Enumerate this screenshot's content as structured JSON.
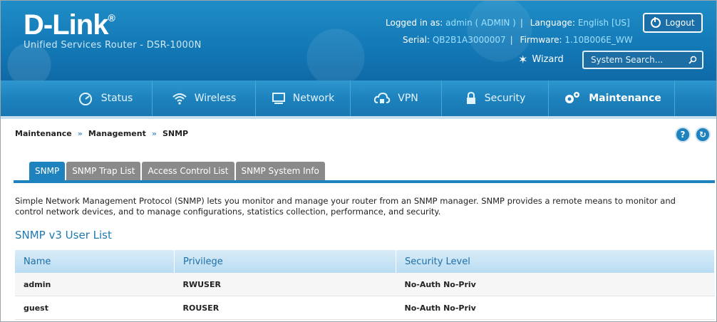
{
  "brand": {
    "logo": "D-Link",
    "reg": "®",
    "subtitle": "Unified Services Router - DSR-1000N"
  },
  "session": {
    "logged_in_label": "Logged in as:",
    "user": "admin ( ADMIN )",
    "language_label": "Language:",
    "language": "English [US]",
    "serial_label": "Serial:",
    "serial": "QB2B1A3000007",
    "firmware_label": "Firmware:",
    "firmware": "1.10B006E_WW",
    "logout_label": "Logout"
  },
  "wizard_label": "Wizard",
  "search": {
    "placeholder": "System Search..."
  },
  "nav": {
    "items": [
      {
        "label": "Status",
        "icon": "speedometer-icon"
      },
      {
        "label": "Wireless",
        "icon": "wifi-icon"
      },
      {
        "label": "Network",
        "icon": "monitor-icon"
      },
      {
        "label": "VPN",
        "icon": "cloud-lock-icon"
      },
      {
        "label": "Security",
        "icon": "lock-icon"
      },
      {
        "label": "Maintenance",
        "icon": "gears-icon"
      }
    ],
    "active": "Maintenance"
  },
  "breadcrumb": {
    "items": [
      "Maintenance",
      "Management",
      "SNMP"
    ],
    "separator": "»"
  },
  "help": {
    "help_glyph": "?",
    "refresh_glyph": "↻"
  },
  "tabs": [
    "SNMP",
    "SNMP Trap List",
    "Access Control List",
    "SNMP System Info"
  ],
  "active_tab": "SNMP",
  "description": "Simple Network Management Protocol (SNMP) lets you monitor and manage your router from an SNMP manager. SNMP provides a remote means to monitor and control network devices, and to manage configurations, statistics collection, performance, and security.",
  "section_title": "SNMP v3 User List",
  "table": {
    "headers": [
      "Name",
      "Privilege",
      "Security Level"
    ],
    "rows": [
      [
        "admin",
        "RWUSER",
        "No-Auth No-Priv"
      ],
      [
        "guest",
        "ROUSER",
        "No-Auth No-Priv"
      ]
    ]
  },
  "colors": {
    "header_blue": "#1378b6",
    "accent": "#1d82bd",
    "tab_inactive": "#8a8a8a"
  }
}
